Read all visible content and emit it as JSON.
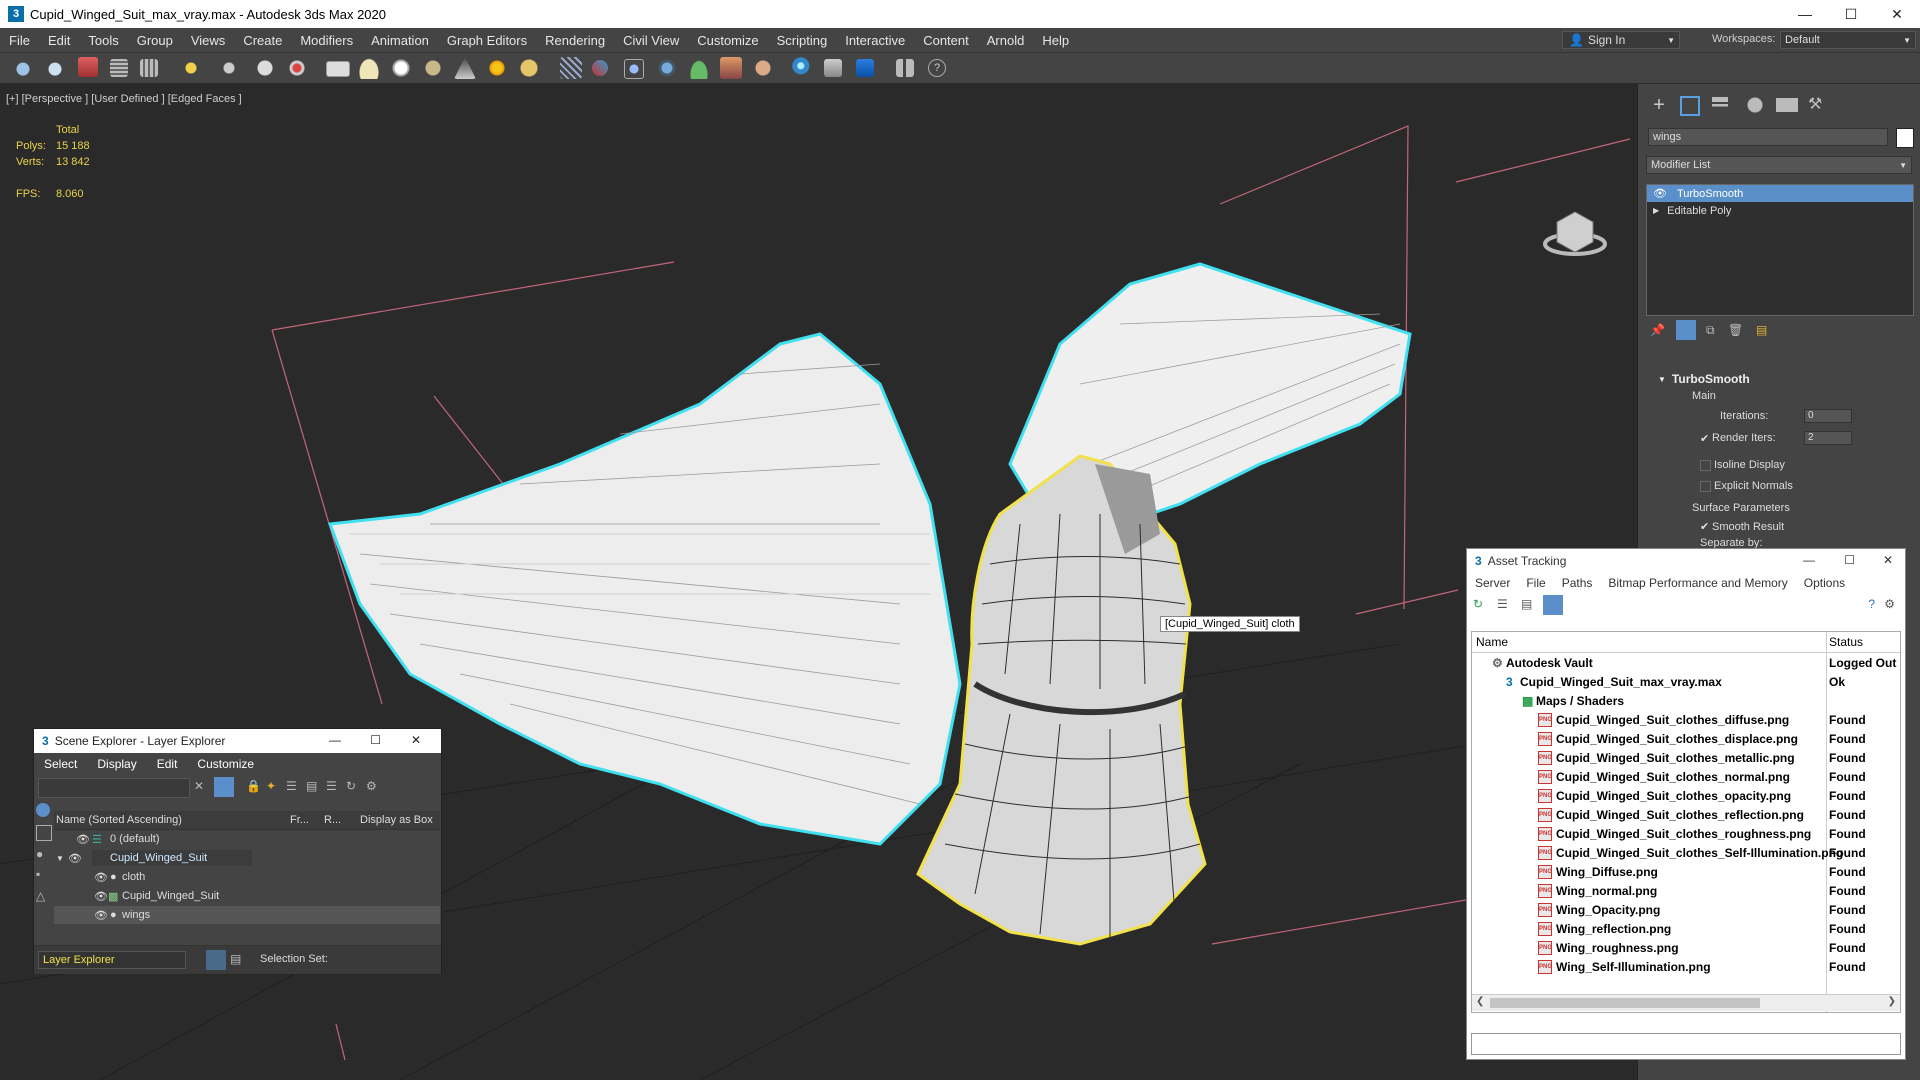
{
  "window": {
    "title": "Cupid_Winged_Suit_max_vray.max - Autodesk 3ds Max 2020",
    "app_icon": "3"
  },
  "menubar": {
    "items": [
      "File",
      "Edit",
      "Tools",
      "Group",
      "Views",
      "Create",
      "Modifiers",
      "Animation",
      "Graph Editors",
      "Rendering",
      "Civil View",
      "Customize",
      "Scripting",
      "Interactive",
      "Content",
      "Arnold",
      "Help"
    ],
    "signin": "Sign In",
    "workspaces_label": "Workspaces:",
    "workspace_value": "Default"
  },
  "viewport": {
    "label": "[+] [Perspective ] [User Defined ] [Edged Faces ]",
    "stats": {
      "total_label": "Total",
      "polys_label": "Polys:",
      "polys": "15 188",
      "verts_label": "Verts:",
      "verts": "13 842",
      "fps_label": "FPS:",
      "fps": "8.060"
    },
    "tooltip": "[Cupid_Winged_Suit] cloth"
  },
  "command_panel": {
    "object_name": "wings",
    "modifier_list": "Modifier List",
    "stack": [
      "TurboSmooth",
      "Editable Poly"
    ],
    "rollout": {
      "title": "TurboSmooth",
      "main": "Main",
      "iterations_label": "Iterations:",
      "iterations": "0",
      "render_iters_label": "Render Iters:",
      "render_iters": "2",
      "isoline": "Isoline Display",
      "explicit": "Explicit Normals",
      "surface": "Surface Parameters",
      "smooth": "Smooth Result",
      "separate": "Separate by:"
    }
  },
  "scene_explorer": {
    "title": "Scene Explorer - Layer Explorer",
    "menu": [
      "Select",
      "Display",
      "Edit",
      "Customize"
    ],
    "columns": [
      "Name (Sorted Ascending)",
      "Fr...",
      "R...",
      "Display as Box"
    ],
    "rows": [
      "0 (default)",
      "Cupid_Winged_Suit",
      "cloth",
      "Cupid_Winged_Suit",
      "wings"
    ],
    "footer_explorer": "Layer Explorer",
    "footer_selset": "Selection Set:"
  },
  "asset_tracking": {
    "title": "Asset Tracking",
    "menu": [
      "Server",
      "File",
      "Paths",
      "Bitmap Performance and Memory",
      "Options"
    ],
    "columns": [
      "Name",
      "Status"
    ],
    "rows": [
      {
        "name": "Autodesk Vault",
        "status": "Logged Out"
      },
      {
        "name": "Cupid_Winged_Suit_max_vray.max",
        "status": "Ok"
      },
      {
        "name": "Maps / Shaders",
        "status": ""
      },
      {
        "name": "Cupid_Winged_Suit_clothes_diffuse.png",
        "status": "Found"
      },
      {
        "name": "Cupid_Winged_Suit_clothes_displace.png",
        "status": "Found"
      },
      {
        "name": "Cupid_Winged_Suit_clothes_metallic.png",
        "status": "Found"
      },
      {
        "name": "Cupid_Winged_Suit_clothes_normal.png",
        "status": "Found"
      },
      {
        "name": "Cupid_Winged_Suit_clothes_opacity.png",
        "status": "Found"
      },
      {
        "name": "Cupid_Winged_Suit_clothes_reflection.png",
        "status": "Found"
      },
      {
        "name": "Cupid_Winged_Suit_clothes_roughness.png",
        "status": "Found"
      },
      {
        "name": "Cupid_Winged_Suit_clothes_Self-Illumination.png",
        "status": "Found"
      },
      {
        "name": "Wing_Diffuse.png",
        "status": "Found"
      },
      {
        "name": "Wing_normal.png",
        "status": "Found"
      },
      {
        "name": "Wing_Opacity.png",
        "status": "Found"
      },
      {
        "name": "Wing_reflection.png",
        "status": "Found"
      },
      {
        "name": "Wing_roughness.png",
        "status": "Found"
      },
      {
        "name": "Wing_Self-Illumination.png",
        "status": "Found"
      }
    ]
  }
}
